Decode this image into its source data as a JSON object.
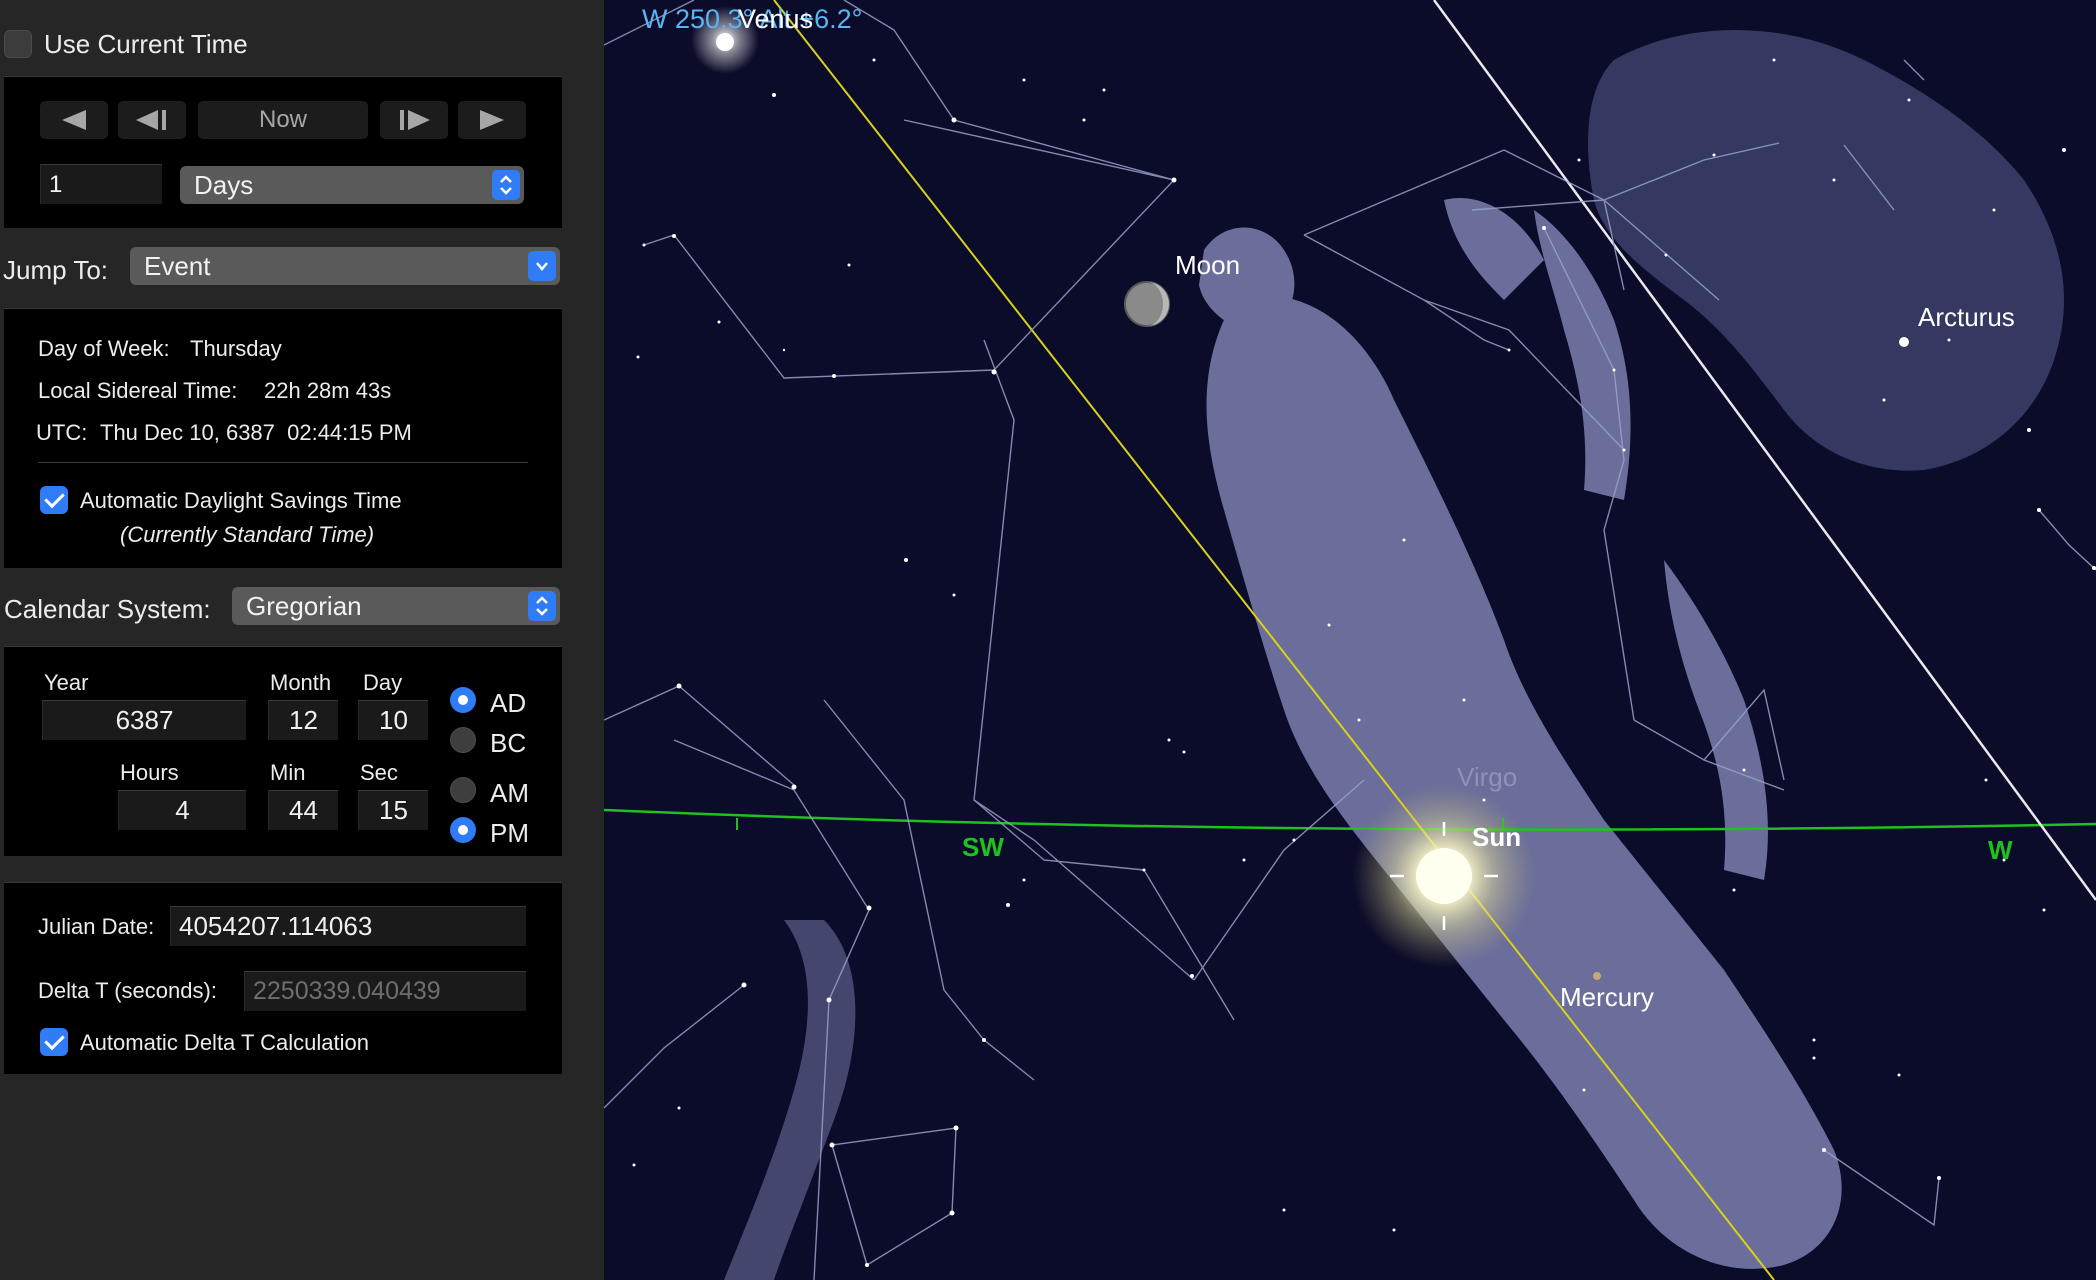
{
  "panel": {
    "use_current_time": {
      "label": "Use Current Time",
      "checked": false
    },
    "time_step": {
      "now_label": "Now",
      "step_value": "1",
      "step_unit": "Days"
    },
    "jump_to": {
      "label": "Jump To:",
      "value": "Event"
    },
    "info": {
      "day_of_week_label": "Day of Week:",
      "day_of_week_value": "Thursday",
      "sidereal_label": "Local Sidereal Time:",
      "sidereal_value": "22h 28m 43s",
      "utc_label": "UTC:",
      "utc_value": "Thu Dec 10, 6387  02:44:15 PM",
      "dst_label": "Automatic Daylight Savings Time",
      "dst_checked": true,
      "dst_status": "(Currently Standard Time)"
    },
    "calendar": {
      "label": "Calendar System:",
      "value": "Gregorian"
    },
    "datetime": {
      "year_label": "Year",
      "year_value": "6387",
      "month_label": "Month",
      "month_value": "12",
      "day_label": "Day",
      "day_value": "10",
      "hours_label": "Hours",
      "hours_value": "4",
      "min_label": "Min",
      "min_value": "44",
      "sec_label": "Sec",
      "sec_value": "15",
      "era_ad": "AD",
      "era_bc": "BC",
      "era_selected": "AD",
      "am": "AM",
      "pm": "PM",
      "ampm_selected": "PM"
    },
    "julian": {
      "julian_label": "Julian Date:",
      "julian_value": "4054207.114063",
      "delta_label": "Delta T (seconds):",
      "delta_value": "2250339.040439",
      "auto_delta_label": "Automatic Delta T Calculation",
      "auto_delta_checked": true
    }
  },
  "sky": {
    "readout": "W 250.3° Alt +6.2°",
    "venus": "Venus",
    "moon": "Moon",
    "arcturus": "Arcturus",
    "virgo": "Virgo",
    "sun": "Sun",
    "mercury": "Mercury",
    "sw": "SW",
    "w": "W",
    "colors": {
      "sky": "#0b0b2a",
      "ecliptic": "#d8d01a",
      "horizon": "#1ec21e",
      "readout": "#5ab4f2",
      "constellation_art": "#7c80ae"
    }
  }
}
